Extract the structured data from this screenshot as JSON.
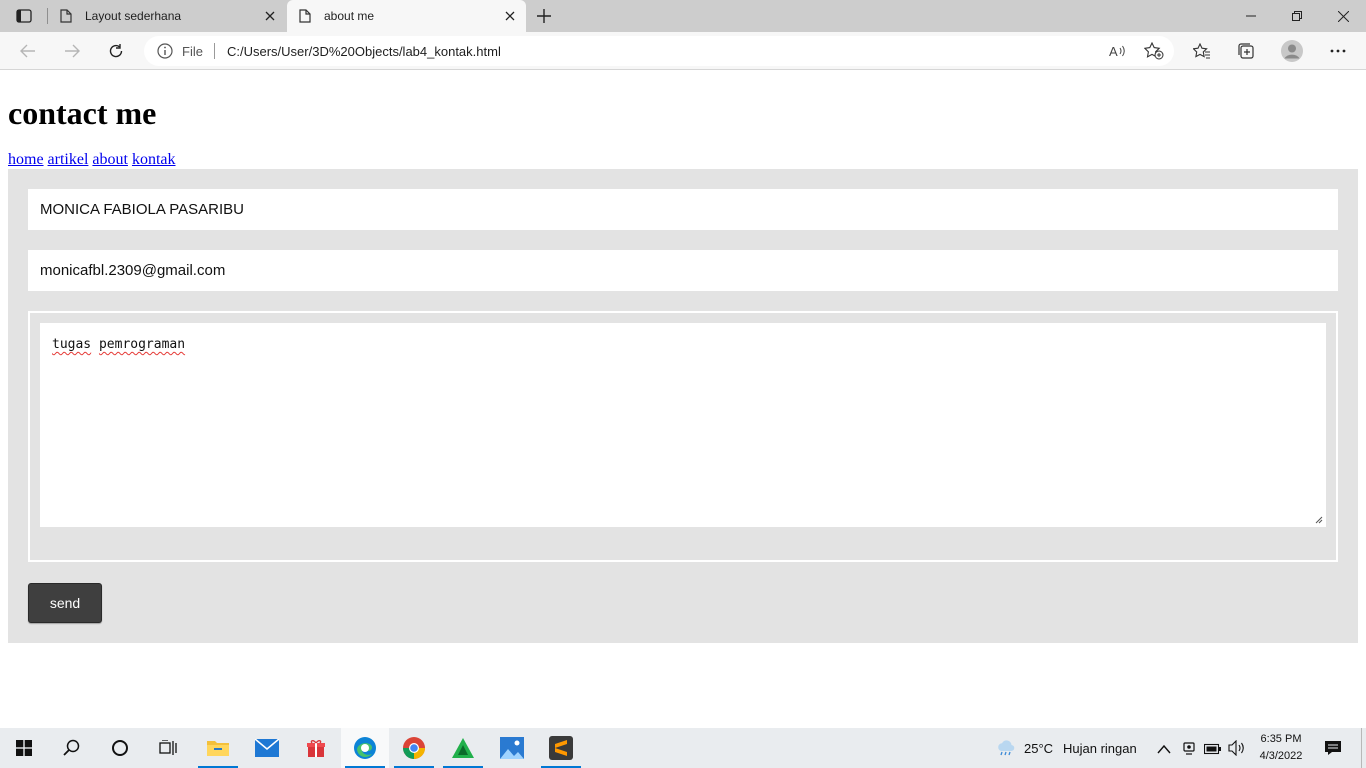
{
  "browser": {
    "tabs": [
      {
        "label": "Layout sederhana",
        "active": false
      },
      {
        "label": "about me",
        "active": true
      }
    ],
    "address": {
      "scheme_label": "File",
      "url": "C:/Users/User/3D%20Objects/lab4_kontak.html"
    }
  },
  "page": {
    "heading": "contact me",
    "nav": [
      "home",
      "artikel",
      "about",
      "kontak"
    ],
    "form": {
      "name_value": "MONICA FABIOLA PASARIBU",
      "email_value": "monicafbl.2309@gmail.com",
      "message_words": [
        "tugas",
        "pemrograman"
      ],
      "send_label": "send"
    },
    "colors": {
      "form_background": "#e3e3e3",
      "button_background": "#3f3f3f",
      "link": "#0000ee"
    }
  },
  "taskbar": {
    "weather_temp": "25°C",
    "weather_desc": "Hujan ringan",
    "time": "6:35 PM",
    "date": "4/3/2022"
  }
}
